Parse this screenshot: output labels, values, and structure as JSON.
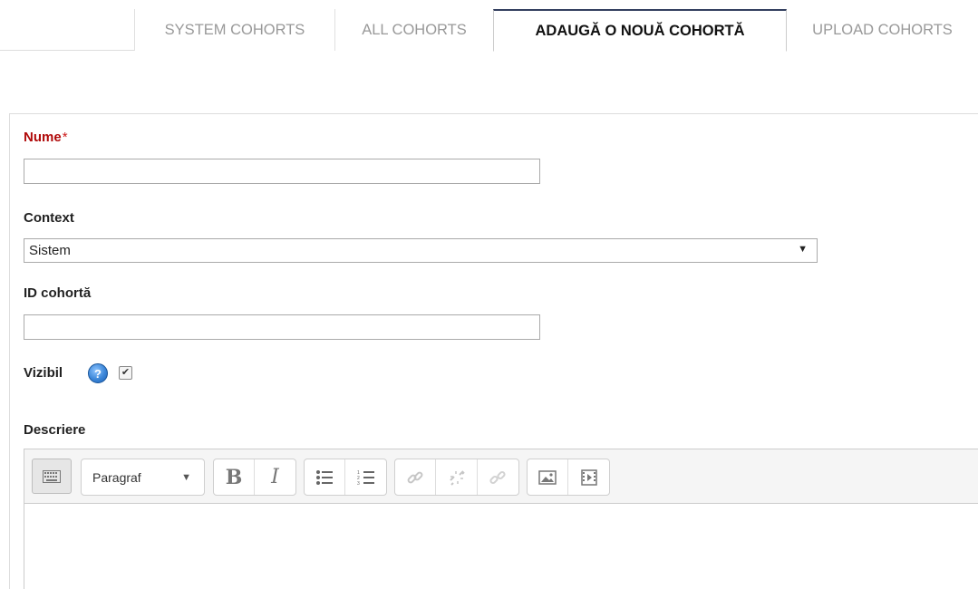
{
  "tabs": [
    {
      "label": "SYSTEM COHORTS",
      "active": false
    },
    {
      "label": "ALL COHORTS",
      "active": false
    },
    {
      "label": "ADAUGĂ O NOUĂ COHORTĂ",
      "active": true
    },
    {
      "label": "UPLOAD COHORTS",
      "active": false
    }
  ],
  "form": {
    "name": {
      "label": "Nume",
      "required_mark": "*",
      "value": ""
    },
    "context": {
      "label": "Context",
      "selected": "Sistem"
    },
    "idnumber": {
      "label": "ID cohortă",
      "value": ""
    },
    "visible": {
      "label": "Vizibil",
      "help_icon": "help-icon",
      "checked": true
    },
    "description": {
      "label": "Descriere"
    }
  },
  "editor": {
    "format_select": "Paragraf",
    "buttons": [
      "toggle-toolbar",
      "bold",
      "italic",
      "bullet-list",
      "numbered-list",
      "link",
      "unlink",
      "anchor",
      "image",
      "media"
    ],
    "bold_glyph": "B",
    "italic_glyph": "I"
  },
  "colors": {
    "active_tab_border": "#333f5f",
    "required_label": "#b00a0a",
    "help_icon": "#3c86d8"
  }
}
